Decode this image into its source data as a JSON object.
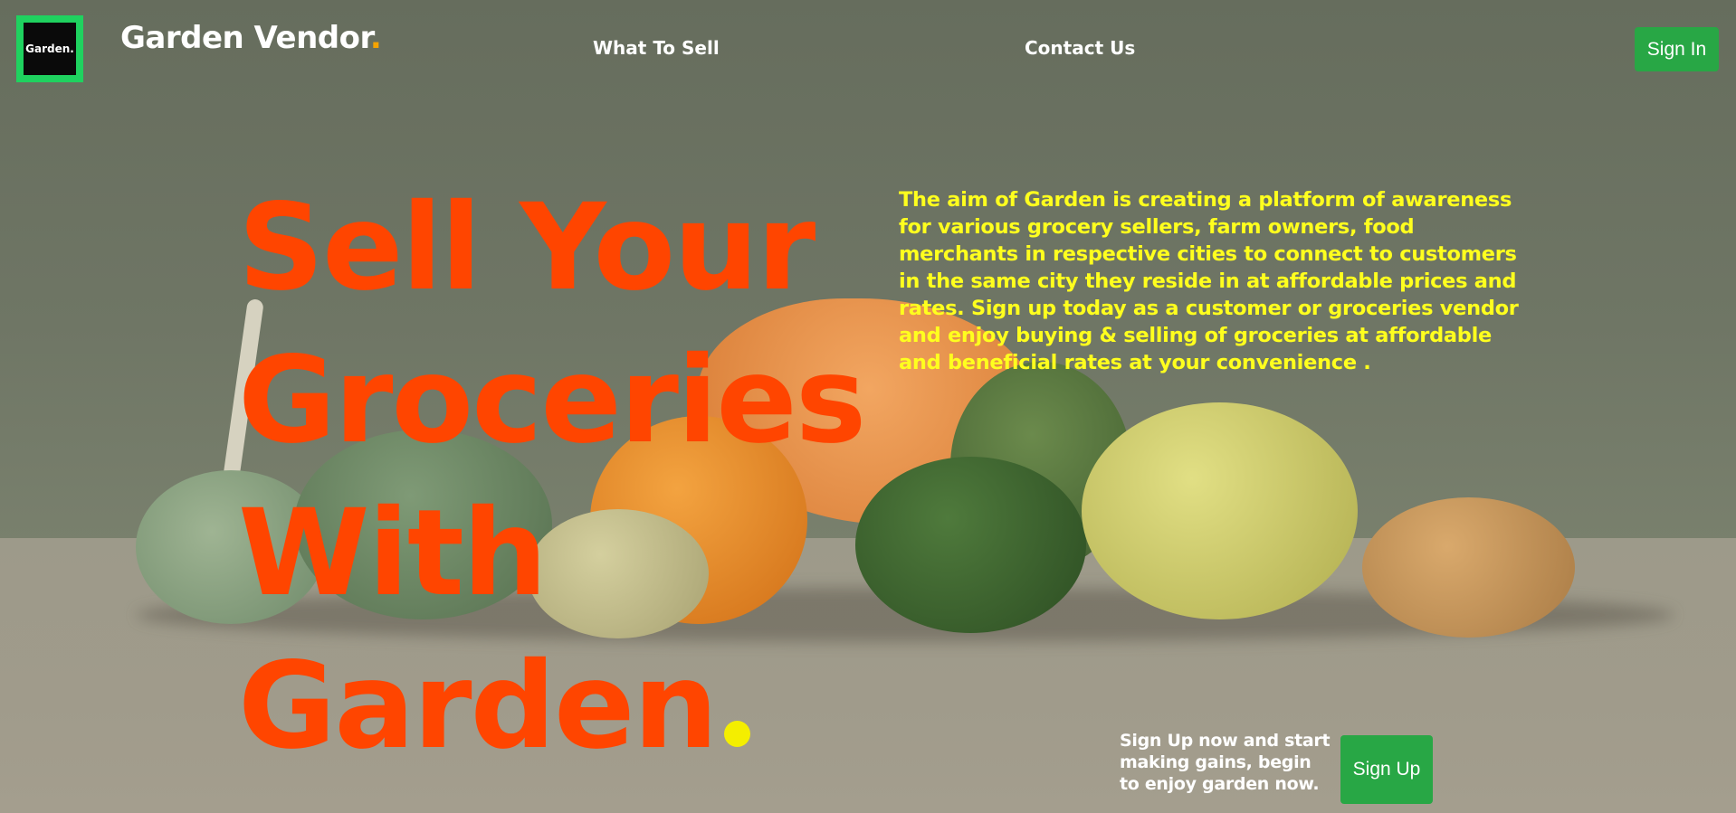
{
  "header": {
    "logo_text": "Garden.",
    "brand_name": "Garden Vendor",
    "brand_dot": ".",
    "nav": {
      "what_to_sell": "What To Sell",
      "contact_us": "Contact Us"
    },
    "sign_in": "Sign In"
  },
  "hero": {
    "headline_lines": [
      "Sell Your",
      "Groceries",
      "With",
      "Garden"
    ],
    "aim_text": "The aim of Garden is creating a platform of awareness for various grocery sellers, farm owners, food merchants in respective cities to connect to customers in the same city they reside in at affordable prices and rates. Sign up today as a customer or groceries vendor and enjoy buying & selling of groceries at affordable and beneficial rates at your convenience .",
    "cta_text": "Sign Up now and start making gains, begin to enjoy garden now.",
    "sign_up": "Sign Up"
  },
  "colors": {
    "accent_green": "#28a745",
    "logo_border": "#1fd25f",
    "headline": "#ff4500",
    "aim_text": "#ffff1e",
    "brand_dot": "#f5a300"
  }
}
